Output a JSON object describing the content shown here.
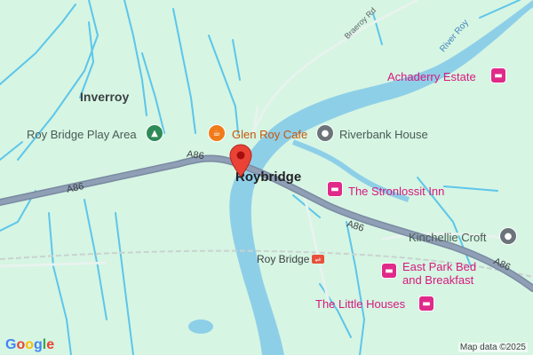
{
  "map": {
    "places": {
      "inverroy": "Inverroy",
      "roybridge": "Roybridge"
    },
    "pois": {
      "play_area": "Roy Bridge Play Area",
      "cafe": "Glen Roy Cafe",
      "riverbank": "Riverbank House",
      "stronlossit": "The Stronlossit Inn",
      "achaderry": "Achaderry Estate",
      "kinchellie": "Kinchellie Croft",
      "east_park_line1": "East Park Bed",
      "east_park_line2": "and Breakfast",
      "little_houses": "The Little Houses"
    },
    "station": "Roy Bridge",
    "roads": {
      "a86": "A86",
      "braeroy": "Braeroy Rd"
    },
    "water": {
      "river_roy": "River Roy"
    },
    "colors": {
      "land": "#d6f5e3",
      "water": "#8ecfe8",
      "stream": "#5cc6ea",
      "road": "#8f9fb5",
      "road_outline": "#7a8aa1",
      "minor_road": "#e8f3ee",
      "poi_pink": "#d6197d",
      "poi_orange": "#c5560b",
      "pin": "#ea4335"
    },
    "icons": {
      "play_area": "park-tree-icon",
      "cafe": "coffee-cup-icon",
      "riverbank": "landmark-dot-icon",
      "stronlossit": "hotel-bed-icon",
      "achaderry": "hotel-bed-icon",
      "kinchellie": "landmark-dot-icon",
      "east_park": "hotel-bed-icon",
      "little_houses": "hotel-bed-icon",
      "station": "train-station-icon",
      "marker": "location-pin-icon"
    }
  },
  "branding": {
    "logo_letters": [
      "G",
      "o",
      "o",
      "g",
      "l",
      "e"
    ],
    "logo_colors": [
      "#4285f4",
      "#ea4335",
      "#fbbc05",
      "#4285f4",
      "#34a853",
      "#ea4335"
    ],
    "attribution": "Map data ©2025"
  }
}
